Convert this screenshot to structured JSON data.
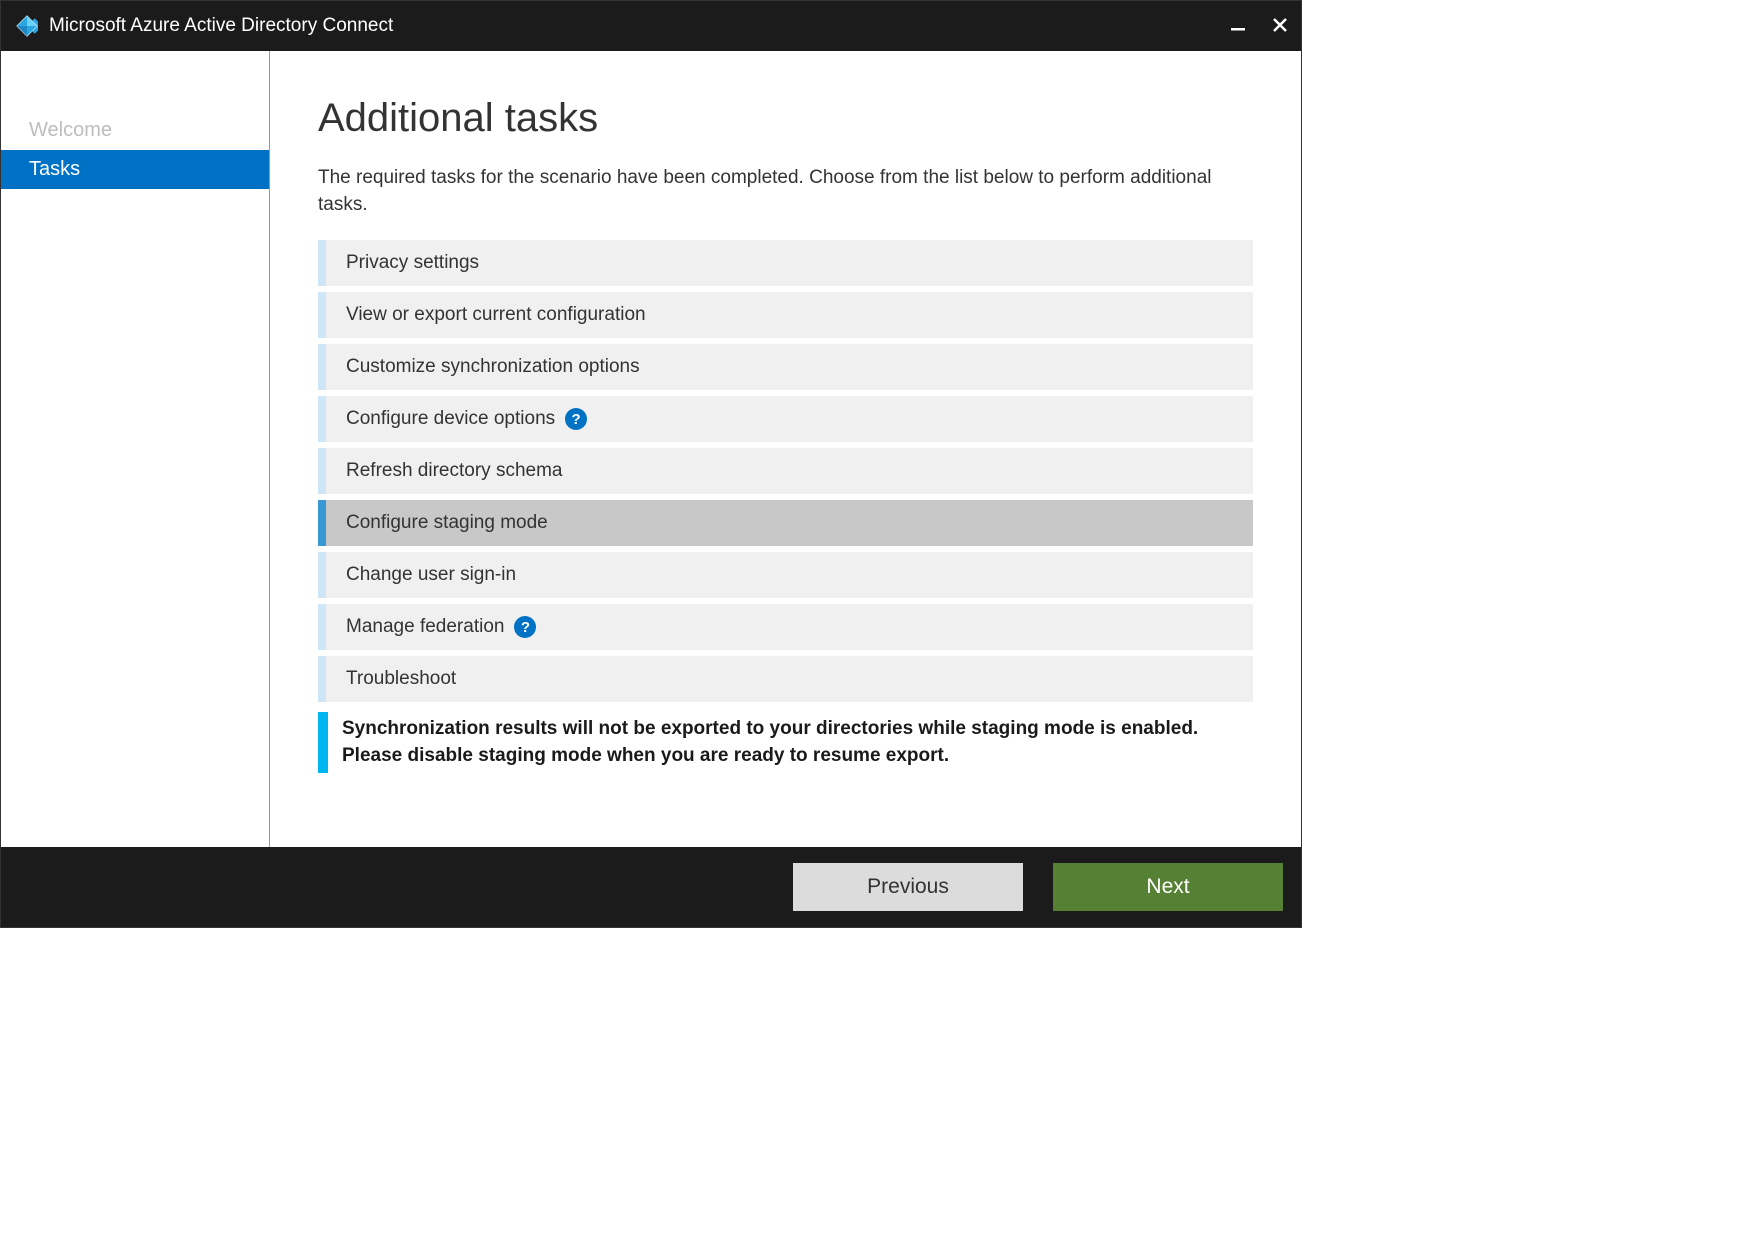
{
  "titlebar": {
    "title": "Microsoft Azure Active Directory Connect"
  },
  "sidebar": {
    "items": [
      {
        "label": "Welcome",
        "state": "inactive"
      },
      {
        "label": "Tasks",
        "state": "active"
      }
    ]
  },
  "main": {
    "heading": "Additional tasks",
    "description": "The required tasks for the scenario have been completed. Choose from the list below to perform additional tasks.",
    "tasks": [
      {
        "label": "Privacy settings",
        "selected": false,
        "help": false
      },
      {
        "label": "View or export current configuration",
        "selected": false,
        "help": false
      },
      {
        "label": "Customize synchronization options",
        "selected": false,
        "help": false
      },
      {
        "label": "Configure device options",
        "selected": false,
        "help": true
      },
      {
        "label": "Refresh directory schema",
        "selected": false,
        "help": false
      },
      {
        "label": "Configure staging mode",
        "selected": true,
        "help": false
      },
      {
        "label": "Change user sign-in",
        "selected": false,
        "help": false
      },
      {
        "label": "Manage federation",
        "selected": false,
        "help": true
      },
      {
        "label": "Troubleshoot",
        "selected": false,
        "help": false
      }
    ],
    "banner": "Synchronization results will not be exported to your directories while staging mode is enabled. Please disable staging mode when you are ready to resume export."
  },
  "footer": {
    "previous": "Previous",
    "next": "Next"
  },
  "help_glyph": "?"
}
